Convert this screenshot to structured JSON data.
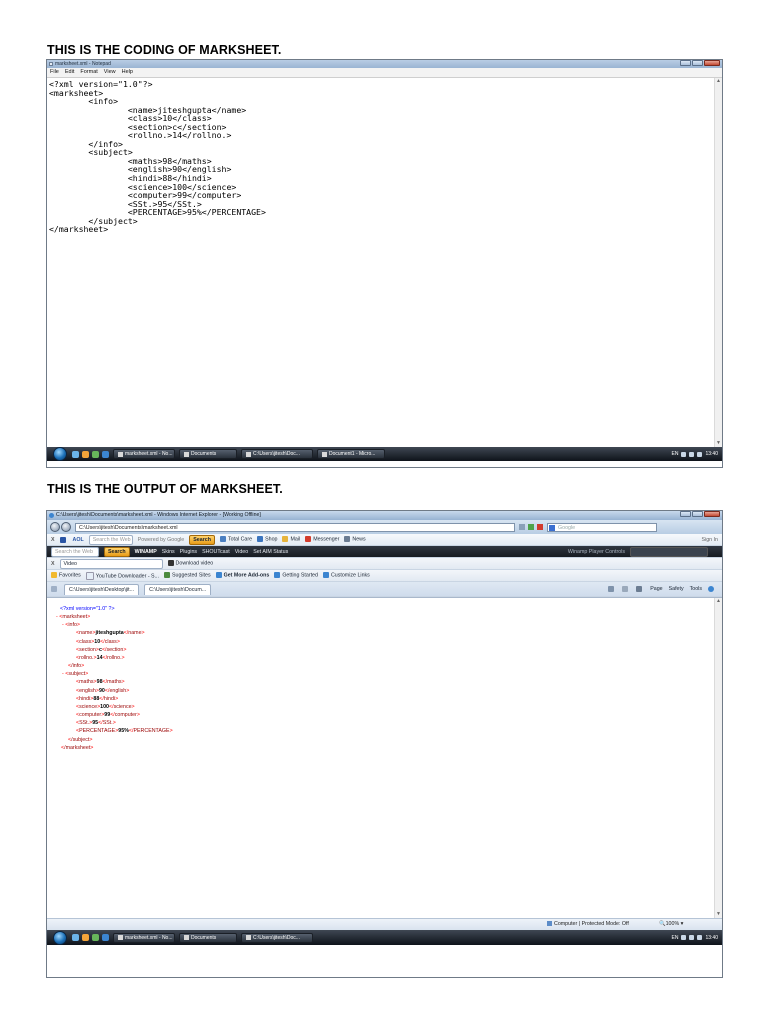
{
  "headings": {
    "coding": "THIS IS THE CODING OF MARKSHEET.",
    "output": "THIS IS THE OUTPUT OF MARKSHEET."
  },
  "notepad": {
    "title": "marksheet.xml - Notepad",
    "menu": [
      "File",
      "Edit",
      "Format",
      "View",
      "Help"
    ],
    "lines": [
      "<?xml version=\"1.0\"?>",
      "<marksheet>",
      "        <info>",
      "                <name>jiteshgupta</name>",
      "                <class>10</class>",
      "                <section>c</section>",
      "                <rollno.>14</rollno.>",
      "        </info>",
      "        <subject>",
      "                <maths>98</maths>",
      "                <english>90</english>",
      "                <hindi>88</hindi>",
      "                <science>100</science>",
      "                <computer>99</computer>",
      "                <SSt.>95</SSt.>",
      "                <PERCENTAGE>95%</PERCENTAGE>",
      "        </subject>",
      "</marksheet>"
    ]
  },
  "taskbar1": {
    "buttons": [
      "marksheet.xml - No...",
      "Documents",
      "C:\\Users\\jitesh\\Doc...",
      "Document1 - Micro..."
    ],
    "lang": "EN",
    "clock": "13:40"
  },
  "ie": {
    "title": "C:\\Users\\jitesh\\Documents\\marksheet.xml - Windows Internet Explorer - [Working Offline]",
    "address": "C:\\Users\\jitesh\\Documents\\marksheet.xml",
    "search_placeholder": "Google",
    "toolbar1": {
      "x": "X",
      "aol": "AOL",
      "search_the_web": "Search the Web",
      "powered_by": "Powered by Google",
      "search_btn": "Search",
      "items": [
        "Total Care",
        "Shop",
        "Mail",
        "Messenger",
        "News"
      ],
      "sign_in": "Sign In"
    },
    "toolbar2": {
      "search_placeholder": "Search the Web",
      "search_btn": "Search",
      "brand": "WINAMP",
      "items": [
        "Skins",
        "Plugins",
        "SHOUTcast",
        "Video",
        "Set AIM Status"
      ],
      "player_controls": "Winamp Player Controls"
    },
    "toolbar3": {
      "x": "X",
      "video_label": "Video",
      "download_video": "Download video"
    },
    "favorites_bar": {
      "favorites": "Favorites",
      "links": [
        "YouTube Downloader - S...",
        "Suggested Sites",
        "Get More Add-ons",
        "Getting Started",
        "Customize Links"
      ]
    },
    "tabs": [
      "C:\\Users\\jitesh\\Desktop\\jit...",
      "C:\\Users\\jitesh\\Docum..."
    ],
    "command_bar": [
      "Page",
      "Safety",
      "Tools"
    ],
    "xml_render": {
      "pi": "<?xml version=\"1.0\" ?>",
      "root_open": "<marksheet>",
      "info_open": "<info>",
      "info_children": [
        {
          "tag": "name",
          "value": "jiteshgupta"
        },
        {
          "tag": "class",
          "value": "10"
        },
        {
          "tag": "section",
          "value": "c"
        },
        {
          "tag": "rollno.",
          "value": "14"
        }
      ],
      "info_close": "</info>",
      "subject_open": "<subject>",
      "subject_children": [
        {
          "tag": "maths",
          "value": "98"
        },
        {
          "tag": "english",
          "value": "90"
        },
        {
          "tag": "hindi",
          "value": "88"
        },
        {
          "tag": "science",
          "value": "100"
        },
        {
          "tag": "computer",
          "value": "99"
        },
        {
          "tag": "SSt.",
          "value": "95"
        },
        {
          "tag": "PERCENTAGE",
          "value": "95%"
        }
      ],
      "subject_close": "</subject>",
      "root_close": "</marksheet>",
      "minus": "-"
    },
    "status": {
      "zone": "Computer | Protected Mode: Off",
      "zoom": "100%"
    }
  },
  "taskbar2": {
    "buttons": [
      "marksheet.xml - No...",
      "Documents",
      "C:\\Users\\jitesh\\Doc..."
    ],
    "lang": "EN",
    "clock": "13:40"
  },
  "colors": {
    "xml_markup": "#ff0000",
    "xml_tag": "#990000",
    "xml_pi": "#0000ff"
  }
}
